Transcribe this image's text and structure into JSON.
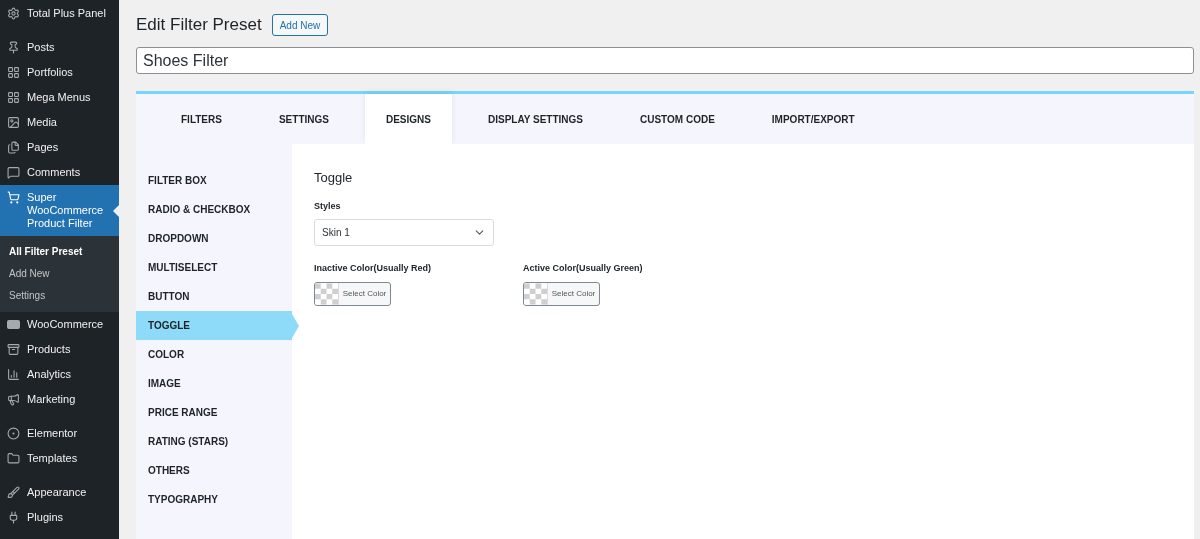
{
  "sidebar": {
    "groups": [
      [
        {
          "label": "Total Plus Panel",
          "selected": false
        }
      ],
      [
        {
          "label": "Posts",
          "selected": false
        },
        {
          "label": "Portfolios",
          "selected": false
        },
        {
          "label": "Mega Menus",
          "selected": false
        },
        {
          "label": "Media",
          "selected": false
        },
        {
          "label": "Pages",
          "selected": false
        },
        {
          "label": "Comments",
          "selected": false
        },
        {
          "label": "Super WooCommerce Product Filter",
          "selected": true,
          "submenu": [
            {
              "label": "All Filter Preset",
              "selected": true
            },
            {
              "label": "Add New",
              "selected": false
            },
            {
              "label": "Settings",
              "selected": false
            }
          ]
        }
      ],
      [
        {
          "label": "WooCommerce",
          "selected": false
        },
        {
          "label": "Products",
          "selected": false
        },
        {
          "label": "Analytics",
          "selected": false
        },
        {
          "label": "Marketing",
          "selected": false
        }
      ],
      [
        {
          "label": "Elementor",
          "selected": false
        },
        {
          "label": "Templates",
          "selected": false
        }
      ],
      [
        {
          "label": "Appearance",
          "selected": false
        },
        {
          "label": "Plugins",
          "selected": false
        }
      ]
    ]
  },
  "page": {
    "title": "Edit Filter Preset",
    "add_new": "Add New",
    "name_value": "Shoes Filter"
  },
  "tabs": [
    {
      "label": "FILTERS",
      "selected": false
    },
    {
      "label": "SETTINGS",
      "selected": false
    },
    {
      "label": "DESIGNS",
      "selected": true
    },
    {
      "label": "DISPLAY SETTINGS",
      "selected": false
    },
    {
      "label": "CUSTOM CODE",
      "selected": false
    },
    {
      "label": "IMPORT/EXPORT",
      "selected": false
    }
  ],
  "design_nav": [
    {
      "label": "FILTER BOX",
      "selected": false
    },
    {
      "label": "RADIO & CHECKBOX",
      "selected": false
    },
    {
      "label": "DROPDOWN",
      "selected": false
    },
    {
      "label": "MULTISELECT",
      "selected": false
    },
    {
      "label": "BUTTON",
      "selected": false
    },
    {
      "label": "TOGGLE",
      "selected": true
    },
    {
      "label": "COLOR",
      "selected": false
    },
    {
      "label": "IMAGE",
      "selected": false
    },
    {
      "label": "PRICE RANGE",
      "selected": false
    },
    {
      "label": "RATING (STARS)",
      "selected": false
    },
    {
      "label": "OTHERS",
      "selected": false
    },
    {
      "label": "TYPOGRAPHY",
      "selected": false
    }
  ],
  "panel": {
    "title": "Toggle",
    "styles_label": "Styles",
    "styles_value": "Skin 1",
    "colors": [
      {
        "label": "Inactive Color(Usually Red)",
        "button": "Select Color"
      },
      {
        "label": "Active Color(Usually Green)",
        "button": "Select Color"
      }
    ]
  }
}
